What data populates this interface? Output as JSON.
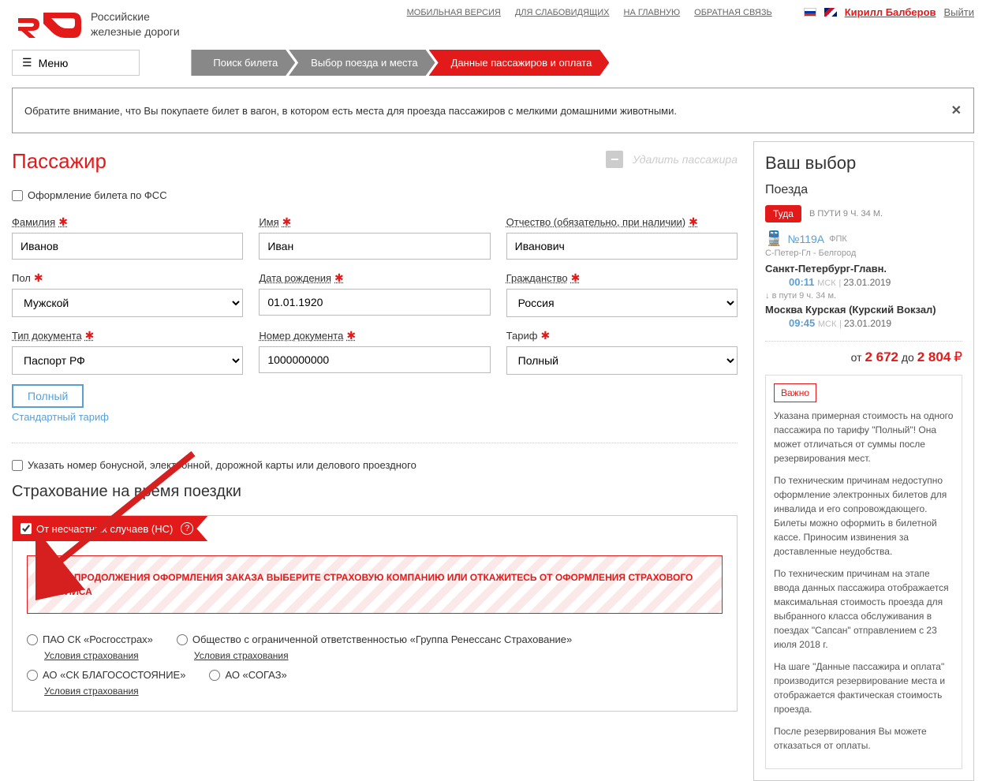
{
  "header": {
    "site_name_1": "Российские",
    "site_name_2": "железные дороги",
    "nav": {
      "mobile": "МОБИЛЬНАЯ ВЕРСИЯ",
      "blind": "ДЛЯ СЛАБОВИДЯЩИХ",
      "home": "НА ГЛАВНУЮ",
      "feedback": "ОБРАТНАЯ СВЯЗЬ"
    },
    "user": "Кирилл Балберов",
    "logout": "Выйти"
  },
  "menu_label": "Меню",
  "breadcrumb": {
    "s1": "Поиск билета",
    "s2": "Выбор поезда и места",
    "s3": "Данные пассажиров и оплата"
  },
  "notice": "Обратите внимание, что Вы покупаете билет в вагон, в котором есть места для проезда пассажиров с мелкими домашними животными.",
  "passenger": {
    "title": "Пассажир",
    "delete": "Удалить пассажира",
    "fss_label": "Оформление билета по ФСС",
    "labels": {
      "surname": "Фамилия",
      "name": "Имя",
      "patronymic": "Отчество (обязательно, при наличии)",
      "sex": "Пол",
      "dob": "Дата рождения",
      "citizenship": "Гражданство",
      "doc_type": "Тип документа",
      "doc_num": "Номер документа",
      "tariff": "Тариф"
    },
    "values": {
      "surname": "Иванов",
      "name": "Иван",
      "patronymic": "Иванович",
      "sex": "Мужской",
      "dob": "01.01.1920",
      "citizenship": "Россия",
      "doc_type": "Паспорт РФ",
      "doc_num": "1000000000",
      "tariff": "Полный"
    },
    "tariff_pill": "Полный",
    "tariff_std": "Стандартный тариф",
    "bonus_label": "Указать номер бонусной, электронной, дорожной карты или делового проездного"
  },
  "insurance": {
    "title": "Страхование на время поездки",
    "ribbon": "От несчастных случаев (НС)",
    "warning": "ДЛЯ ПРОДОЛЖЕНИЯ ОФОРМЛЕНИЯ ЗАКАЗА ВЫБЕРИТЕ СТРАХОВУЮ КОМПАНИЮ ИЛИ ОТКАЖИТЕСЬ ОТ ОФОРМЛЕНИЯ СТРАХОВОГО ПОЛИСА",
    "opts": {
      "ros": "ПАО СК «Росгосстрах»",
      "ren": "Общество с ограниченной ответственностью «Группа Ренессанс Страхование»",
      "blago": "АО «СК БЛАГОСОСТОЯНИЕ»",
      "sogaz": "АО «СОГАЗ»"
    },
    "terms": "Условия страхования"
  },
  "sidebar": {
    "title": "Ваш выбор",
    "trains": "Поезда",
    "tuda": "Туда",
    "travel": "В ПУТИ 9 Ч. 34 М.",
    "train_no": "№119А",
    "fpk": "ФПК",
    "route_short": "С-Петер-Гл - Белгород",
    "dep_station": "Санкт-Петербург-Главн.",
    "dep_time": "00:11",
    "dep_date": "23.01.2019",
    "vputi": "в пути  9 ч. 34 м.",
    "arr_station": "Москва Курская (Курский Вокзал)",
    "arr_time": "09:45",
    "arr_date": "23.01.2019",
    "msk": "МСК",
    "price_from": "от",
    "price1": "2 672",
    "price_to": "до",
    "price2": "2 804",
    "vazhno": "Важно",
    "p1": "Указана примерная стоимость на одного пассажира по тарифу \"Полный\"! Она может отличаться от суммы после резервирования мест.",
    "p2": "По техническим причинам недоступно оформление электронных билетов для инвалида и его сопровождающего. Билеты можно оформить в билетной кассе. Приносим извинения за доставленные неудобства.",
    "p3": "По техническим причинам на этапе ввода данных пассажира отображается максимальная стоимость проезда для выбранного класса обслуживания в поездах \"Сапсан\" отправлением с 23 июля 2018 г.",
    "p4": "На шаге \"Данные пассажира и оплата\" производится резервирование места и отображается фактическая стоимость проезда.",
    "p5": "После резервирования Вы можете отказаться от оплаты."
  }
}
